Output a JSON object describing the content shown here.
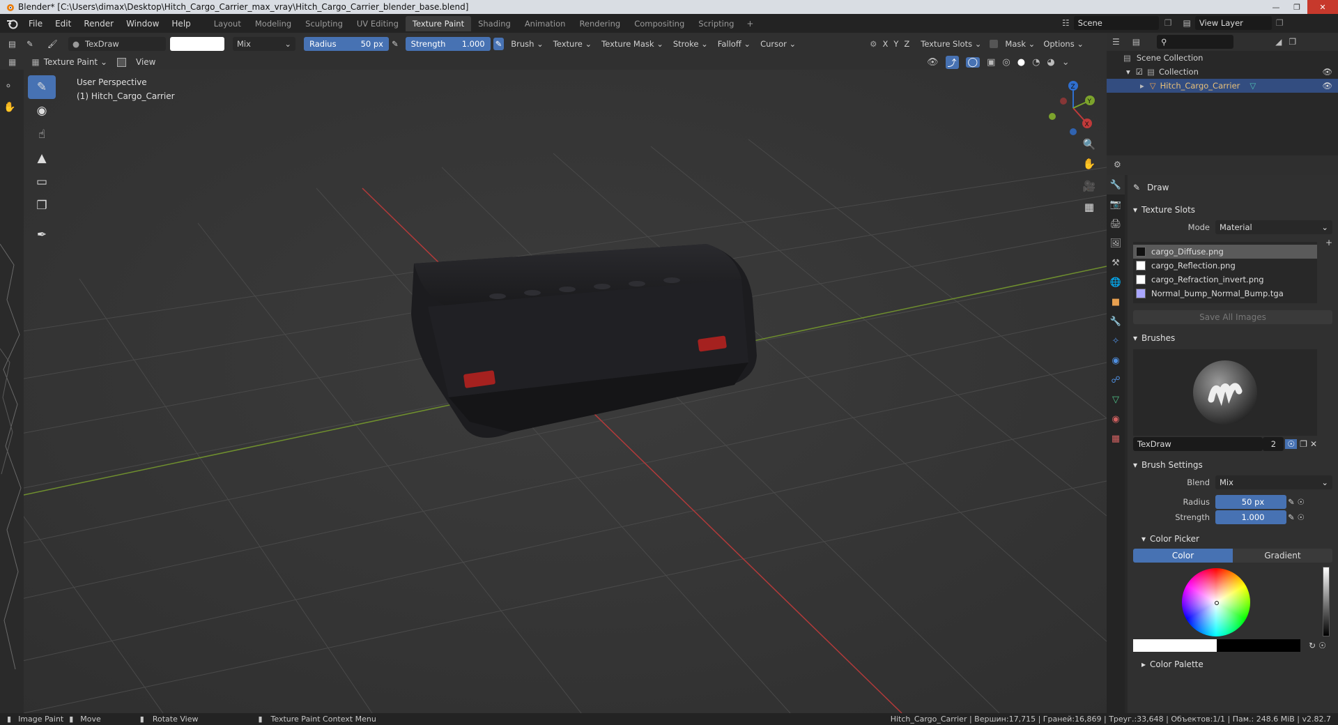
{
  "titlebar": {
    "title": "Blender* [C:\\Users\\dimax\\Desktop\\Hitch_Cargo_Carrier_max_vray\\Hitch_Cargo_Carrier_blender_base.blend]"
  },
  "menu": {
    "items": [
      "File",
      "Edit",
      "Render",
      "Window",
      "Help"
    ]
  },
  "workspaces": {
    "tabs": [
      "Layout",
      "Modeling",
      "Sculpting",
      "UV Editing",
      "Texture Paint",
      "Shading",
      "Animation",
      "Rendering",
      "Compositing",
      "Scripting"
    ],
    "active": "Texture Paint"
  },
  "top_right": {
    "scene": "Scene",
    "view_layer": "View Layer"
  },
  "tool_header": {
    "brush_name": "TexDraw",
    "blend": "Mix",
    "radius_label": "Radius",
    "radius_value": "50 px",
    "strength_label": "Strength",
    "strength_value": "1.000",
    "menus": [
      "Brush",
      "Texture",
      "Texture Mask",
      "Stroke",
      "Falloff",
      "Cursor"
    ],
    "axes": [
      "X",
      "Y",
      "Z"
    ],
    "texture_slots": "Texture Slots",
    "mask": "Mask",
    "options": "Options"
  },
  "viewport_header": {
    "mode": "Texture Paint",
    "view": "View"
  },
  "viewport": {
    "perspective": "User Perspective",
    "object": "(1) Hitch_Cargo_Carrier"
  },
  "outliner": {
    "scene_collection": "Scene Collection",
    "collection": "Collection",
    "object": "Hitch_Cargo_Carrier"
  },
  "properties": {
    "tool_name": "Draw",
    "texture_slots": {
      "title": "Texture Slots",
      "mode_label": "Mode",
      "mode_value": "Material",
      "slots": [
        "cargo_Diffuse.png",
        "cargo_Reflection.png",
        "cargo_Refraction_invert.png",
        "Normal_bump_Normal_Bump.tga"
      ],
      "save_all": "Save All Images"
    },
    "brushes": {
      "title": "Brushes",
      "brush_name": "TexDraw",
      "users": "2"
    },
    "brush_settings": {
      "title": "Brush Settings",
      "blend_label": "Blend",
      "blend_value": "Mix",
      "radius_label": "Radius",
      "radius_value": "50 px",
      "strength_label": "Strength",
      "strength_value": "1.000"
    },
    "color_picker": {
      "title": "Color Picker",
      "tab_color": "Color",
      "tab_gradient": "Gradient"
    },
    "color_palette": "Color Palette"
  },
  "statusbar": {
    "left": [
      "Image Paint",
      "Move",
      "Rotate View",
      "Texture Paint Context Menu"
    ],
    "right": "Hitch_Cargo_Carrier | Вершин:17,715 | Граней:16,869 | Треуг.:33,648 | Объектов:1/1 | Пам.: 248.6 MiB | v2.82.7"
  },
  "colors": {
    "accent": "#4772b3",
    "viewport_bg": "#393939",
    "x_axis": "#b33a3a",
    "y_axis": "#6f8f2e"
  }
}
